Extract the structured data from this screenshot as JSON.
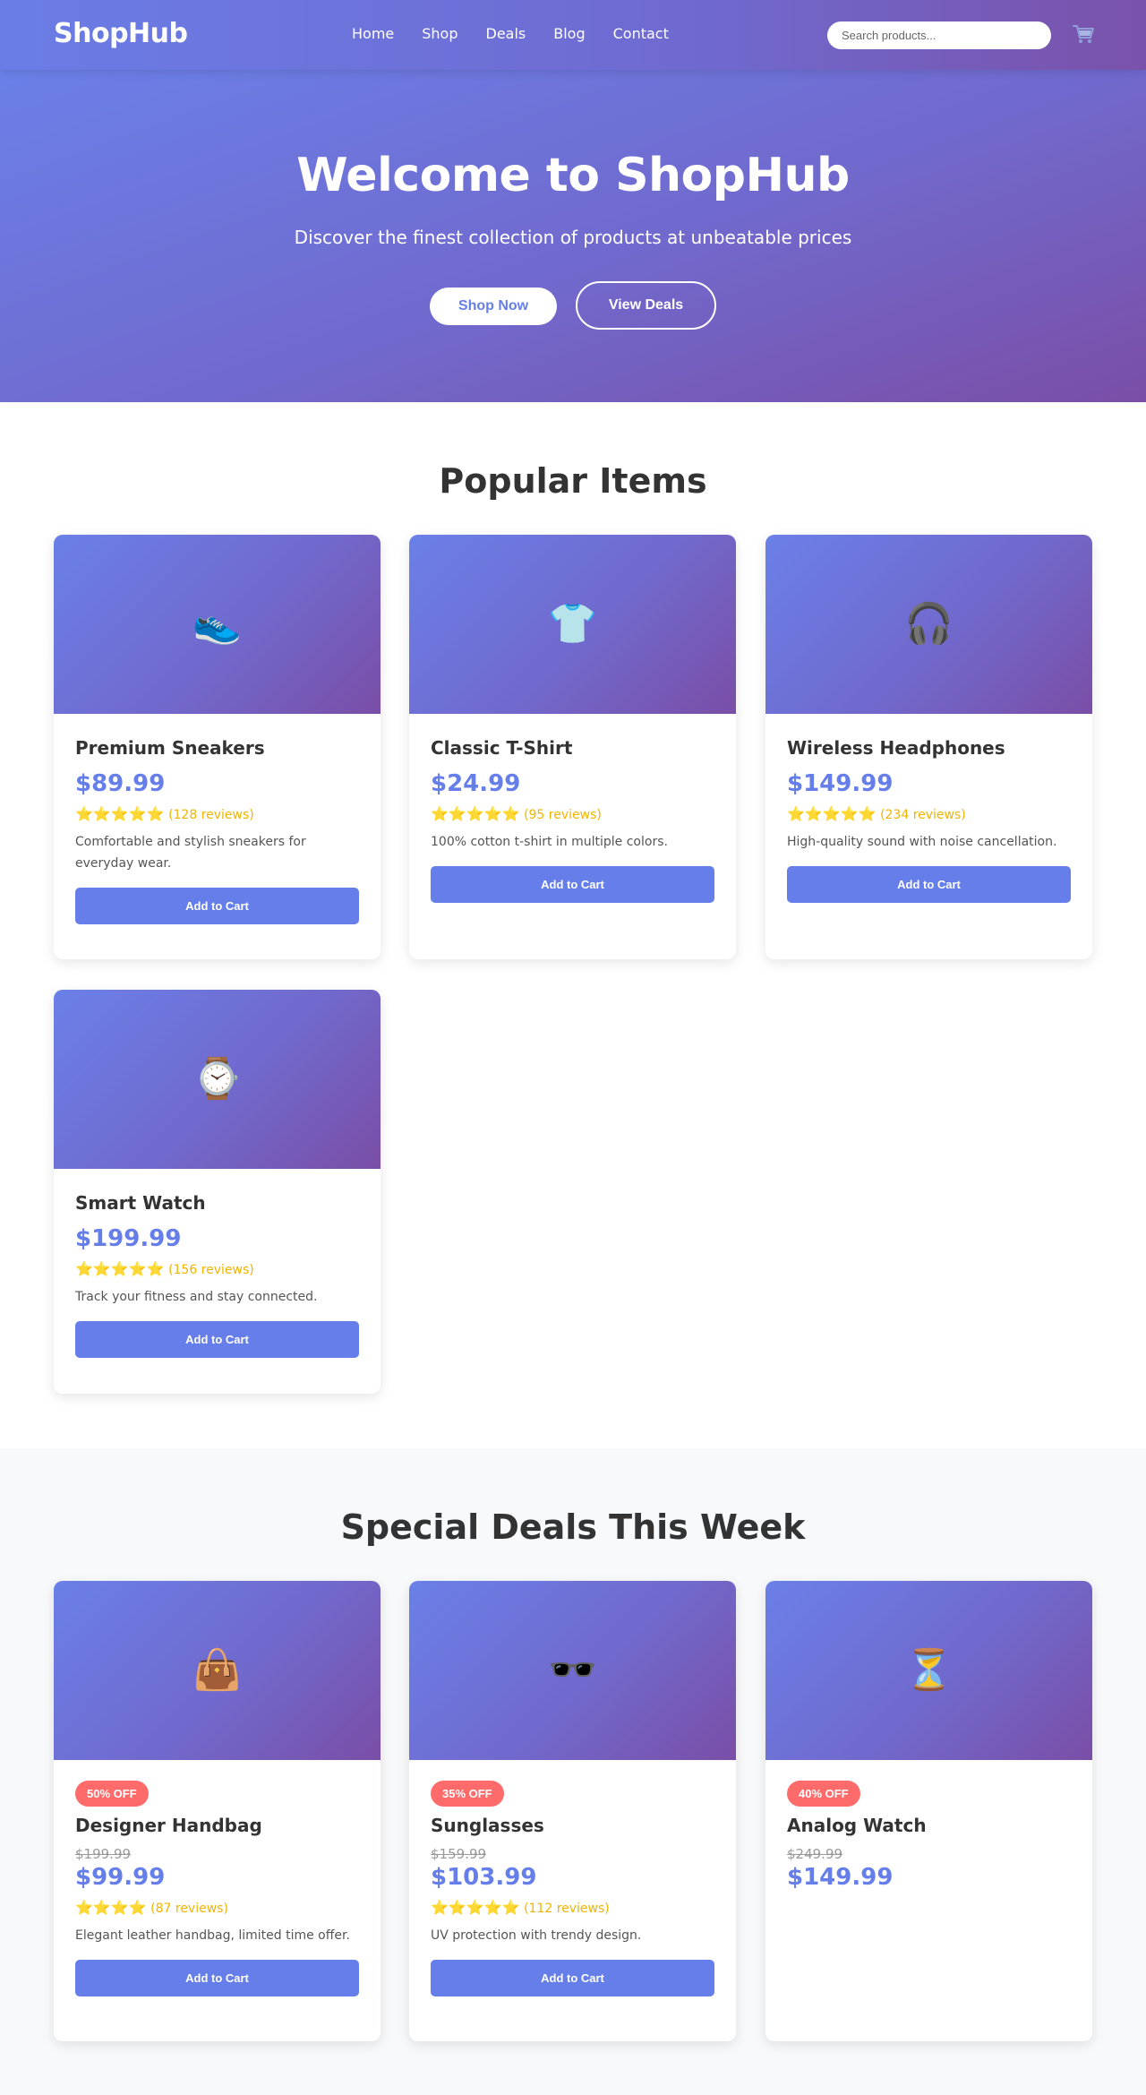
{
  "brand": "ShopHub",
  "nav": {
    "links": [
      "Home",
      "Shop",
      "Deals",
      "Blog",
      "Contact"
    ],
    "search_placeholder": "Search products...",
    "cart_icon": "🛒"
  },
  "hero": {
    "title": "Welcome to ShopHub",
    "subtitle": "Discover the finest collection of products at unbeatable prices",
    "primary_button": "Shop Now",
    "secondary_button": "View Deals"
  },
  "popular": {
    "title": "Popular Items",
    "items": [
      {
        "emoji": "👟",
        "name": "Premium Sneakers",
        "price": "$89.99",
        "stars": "⭐⭐⭐⭐⭐",
        "reviews": "(128 reviews)",
        "description": "Comfortable and stylish sneakers for everyday wear.",
        "button": "Add to Cart"
      },
      {
        "emoji": "👕",
        "name": "Classic T-Shirt",
        "price": "$24.99",
        "stars": "⭐⭐⭐⭐⭐",
        "reviews": "(95 reviews)",
        "description": "100% cotton t-shirt in multiple colors.",
        "button": "Add to Cart"
      },
      {
        "emoji": "🎧",
        "name": "Wireless Headphones",
        "price": "$149.99",
        "stars": "⭐⭐⭐⭐⭐",
        "reviews": "(234 reviews)",
        "description": "High-quality sound with noise cancellation.",
        "button": "Add to Cart"
      },
      {
        "emoji": "⌚",
        "name": "Smart Watch",
        "price": "$199.99",
        "stars": "⭐⭐⭐⭐⭐",
        "reviews": "(156 reviews)",
        "description": "Track your fitness and stay connected.",
        "button": "Add to Cart"
      }
    ]
  },
  "deals": {
    "title": "Special Deals This Week",
    "items": [
      {
        "emoji": "👜",
        "badge": "50% OFF",
        "name": "Designer Handbag",
        "old_price": "$199.99",
        "price": "$99.99",
        "stars": "⭐⭐⭐⭐",
        "reviews": "(87 reviews)",
        "description": "Elegant leather handbag, limited time offer.",
        "button": "Add to Cart"
      },
      {
        "emoji": "🕶️",
        "badge": "35% OFF",
        "name": "Sunglasses",
        "old_price": "$159.99",
        "price": "$103.99",
        "stars": "⭐⭐⭐⭐⭐",
        "reviews": "(112 reviews)",
        "description": "UV protection with trendy design.",
        "button": "Add to Cart"
      },
      {
        "emoji": "⏳",
        "badge": "40% OFF",
        "name": "Analog Watch",
        "old_price": "$249.99",
        "price": "$149.99"
      }
    ]
  },
  "colors": {
    "accent": "#667eea",
    "gradient_end": "#764ba2",
    "badge": "#ff6b6b",
    "star": "#f5c518"
  }
}
